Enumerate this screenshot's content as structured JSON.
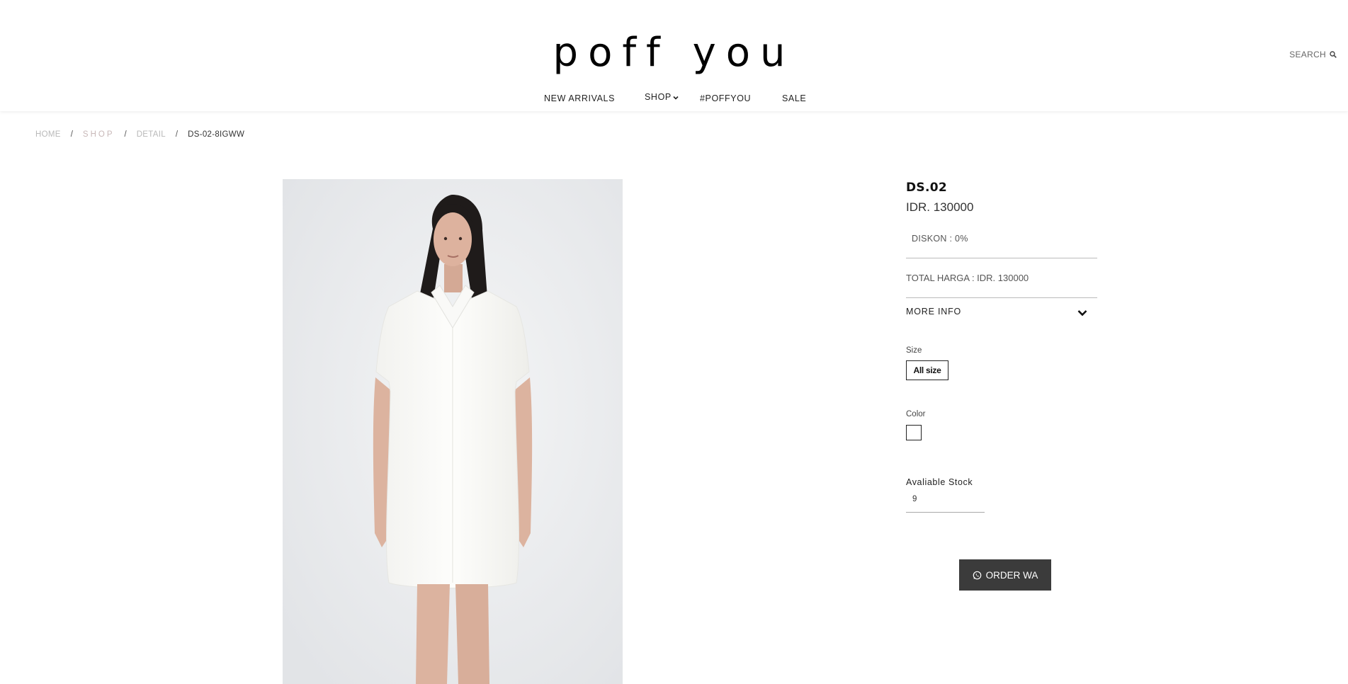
{
  "header": {
    "logo": "poff you",
    "search_label": "SEARCH",
    "nav": {
      "new_arrivals": "NEW ARRIVALS",
      "shop": "SHOP",
      "poffyou": "#POFFYOU",
      "sale": "SALE"
    }
  },
  "breadcrumb": {
    "home": "HOME",
    "shop": "SHOP",
    "detail": "DETAIL",
    "current": "DS-02-8IGWW",
    "separator": "/"
  },
  "product": {
    "title": "DS.02",
    "price": "IDR. 130000",
    "discount": "DISKON : 0%",
    "total": "TOTAL HARGA : IDR. 130000",
    "more_info": "MORE INFO",
    "size_label": "Size",
    "size_option": "All size",
    "color_label": "Color",
    "color_swatch": "#ffffff",
    "stock_label": "Avaliable Stock",
    "stock_value": "9",
    "order_button": "ORDER WA"
  },
  "colors": {
    "button_bg": "#3b3b3b",
    "photo_bg": "#eceef0",
    "dress": "#fbfbf9"
  },
  "icons": {
    "search": "search-icon",
    "shop_dropdown": "chevron-down-icon",
    "more_info": "chevron-down-icon",
    "order": "whatsapp-icon"
  }
}
